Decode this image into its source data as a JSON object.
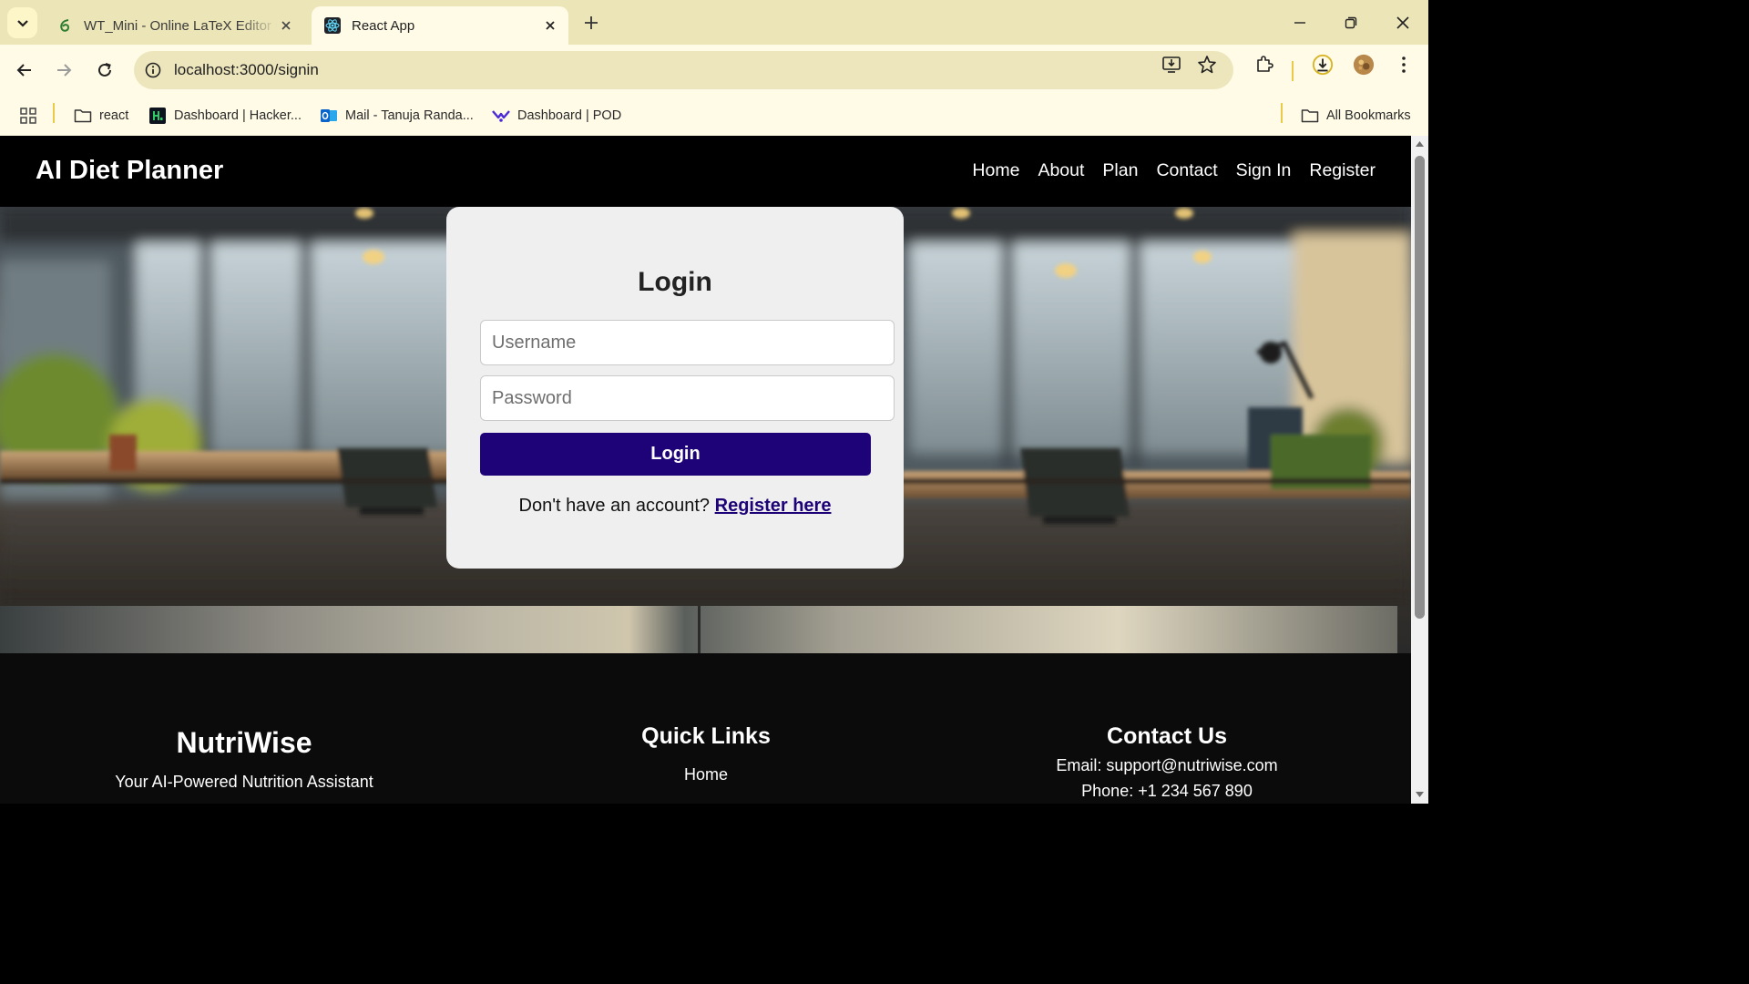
{
  "browser": {
    "tabs": [
      {
        "title": "WT_Mini - Online LaTeX Editor Overleaf",
        "favicon": "overleaf-icon",
        "active": false
      },
      {
        "title": "React App",
        "favicon": "react-icon",
        "active": true
      }
    ],
    "url": "localhost:3000/signin",
    "bookmarks": [
      {
        "label": "react",
        "icon": "folder-icon"
      },
      {
        "label": "Dashboard | Hacker...",
        "icon": "hackerrank-icon"
      },
      {
        "label": "Mail - Tanuja Randa...",
        "icon": "outlook-icon"
      },
      {
        "label": "Dashboard | POD",
        "icon": "pod-icon"
      }
    ],
    "all_bookmarks": "All Bookmarks"
  },
  "navbar": {
    "brand": "AI Diet Planner",
    "links": [
      "Home",
      "About",
      "Plan",
      "Contact",
      "Sign In",
      "Register"
    ]
  },
  "login": {
    "title": "Login",
    "username_placeholder": "Username",
    "password_placeholder": "Password",
    "button": "Login",
    "register_prompt": "Don't have an account?",
    "register_link": "Register here"
  },
  "footer": {
    "brand": "NutriWise",
    "tagline": "Your AI-Powered Nutrition Assistant",
    "quick_links_title": "Quick Links",
    "quick_links": [
      "Home"
    ],
    "contact_title": "Contact Us",
    "email": "Email: support@nutriwise.com",
    "phone": "Phone: +1 234 567 890"
  },
  "colors": {
    "primary": "#1e0378",
    "chrome": "#fffbe7",
    "tabstrip": "#ece5b8"
  }
}
